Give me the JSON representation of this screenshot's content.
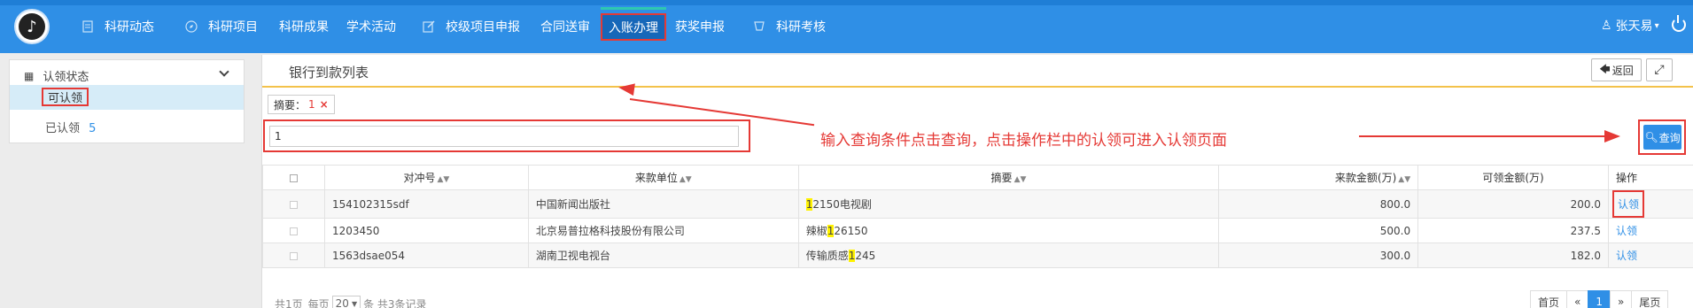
{
  "nav": {
    "items": [
      {
        "label": "科研动态",
        "icon": "document-icon"
      },
      {
        "label": "科研项目",
        "icon": "compass-icon"
      },
      {
        "label": "科研成果",
        "icon": ""
      },
      {
        "label": "学术活动",
        "icon": ""
      },
      {
        "label": "校级项目申报",
        "icon": "edit-icon"
      },
      {
        "label": "合同送审",
        "icon": ""
      },
      {
        "label": "入账办理",
        "icon": "",
        "active": true
      },
      {
        "label": "获奖申报",
        "icon": ""
      },
      {
        "label": "科研考核",
        "icon": "cup-icon"
      }
    ],
    "user": "张天易",
    "user_caret": "▾"
  },
  "sidebar": {
    "header": "认领状态",
    "items": [
      {
        "label": "可认领",
        "selected": true
      },
      {
        "label": "已认领",
        "count": "5"
      }
    ]
  },
  "panel": {
    "title": "银行到款列表",
    "back_label": "返回",
    "filter_label": "摘要：",
    "filter_value": "1",
    "filter_remove": "×",
    "search_value": "1",
    "query_label": "查询",
    "annotation": "输入查询条件点击查询，点击操作栏中的认领可进入认领页面"
  },
  "table": {
    "headers": [
      "对冲号",
      "来款单位",
      "摘要",
      "来款金额(万)",
      "可领金额(万)",
      "操作"
    ],
    "rows": [
      {
        "code": "154102315sdf",
        "unit": "中国新闻出版社",
        "summary_pre": "",
        "summary_hl": "1",
        "summary_post": "2150电视剧",
        "amount": "800.0",
        "claimable": "200.0",
        "action": "认领"
      },
      {
        "code": "1203450",
        "unit": "北京易普拉格科技股份有限公司",
        "summary_pre": "辣椒",
        "summary_hl": "1",
        "summary_post": "26150",
        "amount": "500.0",
        "claimable": "237.5",
        "action": "认领"
      },
      {
        "code": "1563dsae054",
        "unit": "湖南卫视电视台",
        "summary_pre": "传输质感",
        "summary_hl": "1",
        "summary_post": "245",
        "amount": "300.0",
        "claimable": "182.0",
        "action": "认领"
      }
    ]
  },
  "footer": {
    "pages_text": "共1页",
    "per_page_label": "每页",
    "per_page_value": "20",
    "records_text": "条 共3条记录"
  },
  "pager": {
    "first": "首页",
    "prev": "«",
    "current": "1",
    "next": "»",
    "last": "尾页"
  },
  "colors": {
    "nav_bg": "#2f8fe6",
    "accent_red": "#e53935",
    "highlight": "#fff200",
    "link": "#2f8fe6"
  }
}
